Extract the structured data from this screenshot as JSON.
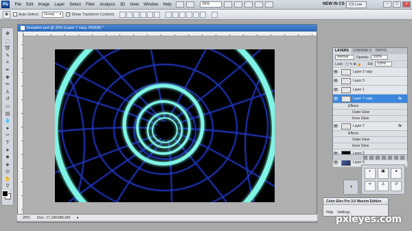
{
  "menubar": {
    "logo": "Ps",
    "items": [
      "File",
      "Edit",
      "Image",
      "Layer",
      "Select",
      "Filter",
      "Analysis",
      "3D",
      "View",
      "Window",
      "Help"
    ],
    "zoom": "25%",
    "workspace": "NEW IN CS 5",
    "cslive": "CS Live"
  },
  "options": {
    "auto_select_label": "Auto-Select:",
    "auto_select_value": "Group",
    "show_transform_label": "Show Transform Controls"
  },
  "document": {
    "title": "loooption.psd @ 25% (Layer 7 copy, RGB/8) *",
    "zoom": "25%",
    "doc_info": "Doc: 17,1M/386,0M"
  },
  "layers_panel": {
    "tabs": [
      "LAYERS",
      "CHANNELS",
      "PATHS"
    ],
    "blend_mode": "Normal",
    "opacity_label": "Opacity:",
    "opacity_value": "100%",
    "lock_label": "Lock:",
    "fill_label": "Fill:",
    "fill_value": "100%",
    "layers": [
      {
        "name": "Layer 2 copy",
        "kind": "layer"
      },
      {
        "name": "Layer 3",
        "kind": "layer"
      },
      {
        "name": "Layer 1",
        "kind": "layer"
      },
      {
        "name": "Layer 7 copy",
        "kind": "layer",
        "selected": true,
        "fx": "fx"
      },
      {
        "name": "Effects",
        "kind": "effects"
      },
      {
        "name": "Outer Glow",
        "kind": "effect"
      },
      {
        "name": "Inner Glow",
        "kind": "effect"
      },
      {
        "name": "Layer 7",
        "kind": "layer",
        "fx": "fx"
      },
      {
        "name": "Effects",
        "kind": "effects"
      },
      {
        "name": "Outer Glow",
        "kind": "effect"
      },
      {
        "name": "Inner Glow",
        "kind": "effect"
      },
      {
        "name": "Layer 2",
        "kind": "layer",
        "thumb": "black"
      },
      {
        "name": "Layer 0",
        "kind": "layer",
        "thumb": "blue"
      }
    ]
  },
  "plugin": {
    "title": "Color Efex Pro 3.0 Wacom Edition",
    "help": "Help",
    "settings": "Settings"
  },
  "watermark": "pxleyes.com",
  "colors": {
    "ring": "#7ff5e6",
    "wire": "#2238c8",
    "selected_layer": "#3b87dd"
  }
}
